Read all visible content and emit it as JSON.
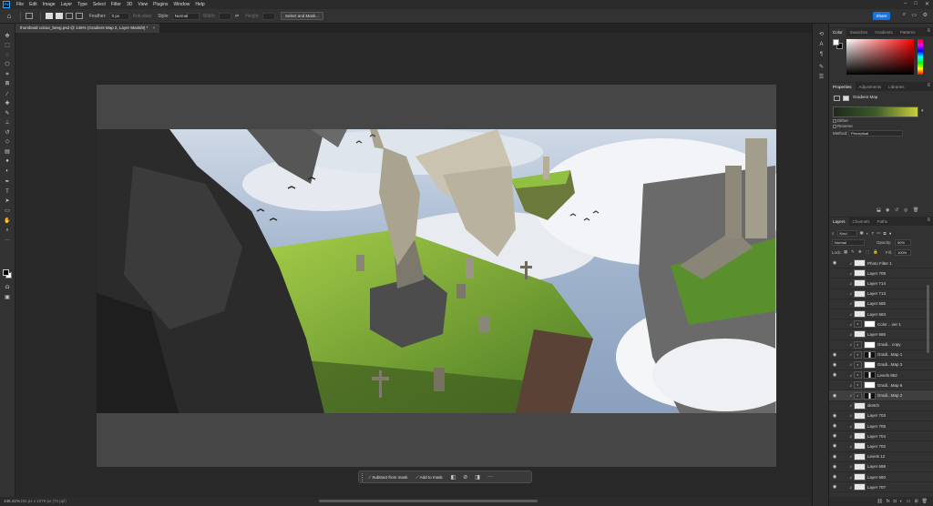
{
  "menubar": {
    "logo": "Ps",
    "items": [
      "File",
      "Edit",
      "Image",
      "Layer",
      "Type",
      "Select",
      "Filter",
      "3D",
      "View",
      "Plugins",
      "Window",
      "Help"
    ]
  },
  "options": {
    "feather_label": "Feather:",
    "feather_value": "0 px",
    "antialias_label": "Anti-alias",
    "style_label": "Style:",
    "style_value": "Normal",
    "width_label": "Width:",
    "height_label": "Height:",
    "select_mask_label": "Select and Mask...",
    "share_label": "Share"
  },
  "document": {
    "tab_title": "thumbnail colour_beeg.psd @ 146% (Gradient Map 2, Layer Mask/8) *",
    "close": "×"
  },
  "taskbar": {
    "subtract_label": "Subtract from mask",
    "add_label": "Add to mask",
    "more": "···"
  },
  "status": {
    "zoom": "146.41%",
    "dims": "192 px x 1076 px (72 ppi)"
  },
  "color_panel": {
    "tabs": [
      "Color",
      "Swatches",
      "Gradients",
      "Patterns"
    ]
  },
  "properties_panel": {
    "tabs": [
      "Properties",
      "Adjustments",
      "Libraries"
    ],
    "title": "Gradient Map",
    "dither_label": "Dither",
    "reverse_label": "Reverse",
    "method_label": "Method:",
    "method_value": "Perceptual"
  },
  "layers_panel": {
    "tabs": [
      "Layers",
      "Channels",
      "Paths"
    ],
    "filter_label": "Kind",
    "blend_mode": "Normal",
    "opacity_label": "Opacity:",
    "opacity_value": "90%",
    "lock_label": "Lock:",
    "fill_label": "Fill:",
    "fill_value": "100%",
    "layers": [
      {
        "name": "Photo Filter 1",
        "visible": true,
        "kind": "layer"
      },
      {
        "name": "Layer 709",
        "visible": false,
        "kind": "layer"
      },
      {
        "name": "Layer 714",
        "visible": false,
        "kind": "layer"
      },
      {
        "name": "Layer 713",
        "visible": false,
        "kind": "layer"
      },
      {
        "name": "Layer 685",
        "visible": false,
        "kind": "layer"
      },
      {
        "name": "Layer 683",
        "visible": false,
        "kind": "layer"
      },
      {
        "name": "Color ...ver 1",
        "visible": false,
        "kind": "adj-mask"
      },
      {
        "name": "Layer 686",
        "visible": false,
        "kind": "layer"
      },
      {
        "name": "Gradi... copy",
        "visible": false,
        "kind": "adj-mask"
      },
      {
        "name": "Gradi...Map 1",
        "visible": true,
        "kind": "adj-mask"
      },
      {
        "name": "Gradi...Map 3",
        "visible": true,
        "kind": "adj-mask"
      },
      {
        "name": "Levels 862",
        "visible": true,
        "kind": "adj-mask"
      },
      {
        "name": "Gradi...Map 6",
        "visible": false,
        "kind": "adj-mask"
      },
      {
        "name": "Gradi...Map 2",
        "visible": true,
        "kind": "adj-mask",
        "selected": true
      },
      {
        "name": "sketch",
        "visible": false,
        "kind": "layer"
      },
      {
        "name": "Layer 703",
        "visible": true,
        "kind": "layer"
      },
      {
        "name": "Layer 705",
        "visible": true,
        "kind": "layer"
      },
      {
        "name": "Layer 704",
        "visible": true,
        "kind": "layer"
      },
      {
        "name": "Layer 702",
        "visible": true,
        "kind": "layer"
      },
      {
        "name": "Levels 12",
        "visible": true,
        "kind": "group"
      },
      {
        "name": "Layer 698",
        "visible": true,
        "kind": "layer"
      },
      {
        "name": "Layer 660",
        "visible": true,
        "kind": "layer"
      },
      {
        "name": "Layer 707",
        "visible": true,
        "kind": "layer"
      }
    ]
  },
  "colors": {
    "accent": "#1473e6",
    "gradient_start": "#1d2a1c",
    "gradient_end": "#c8cf3c"
  }
}
